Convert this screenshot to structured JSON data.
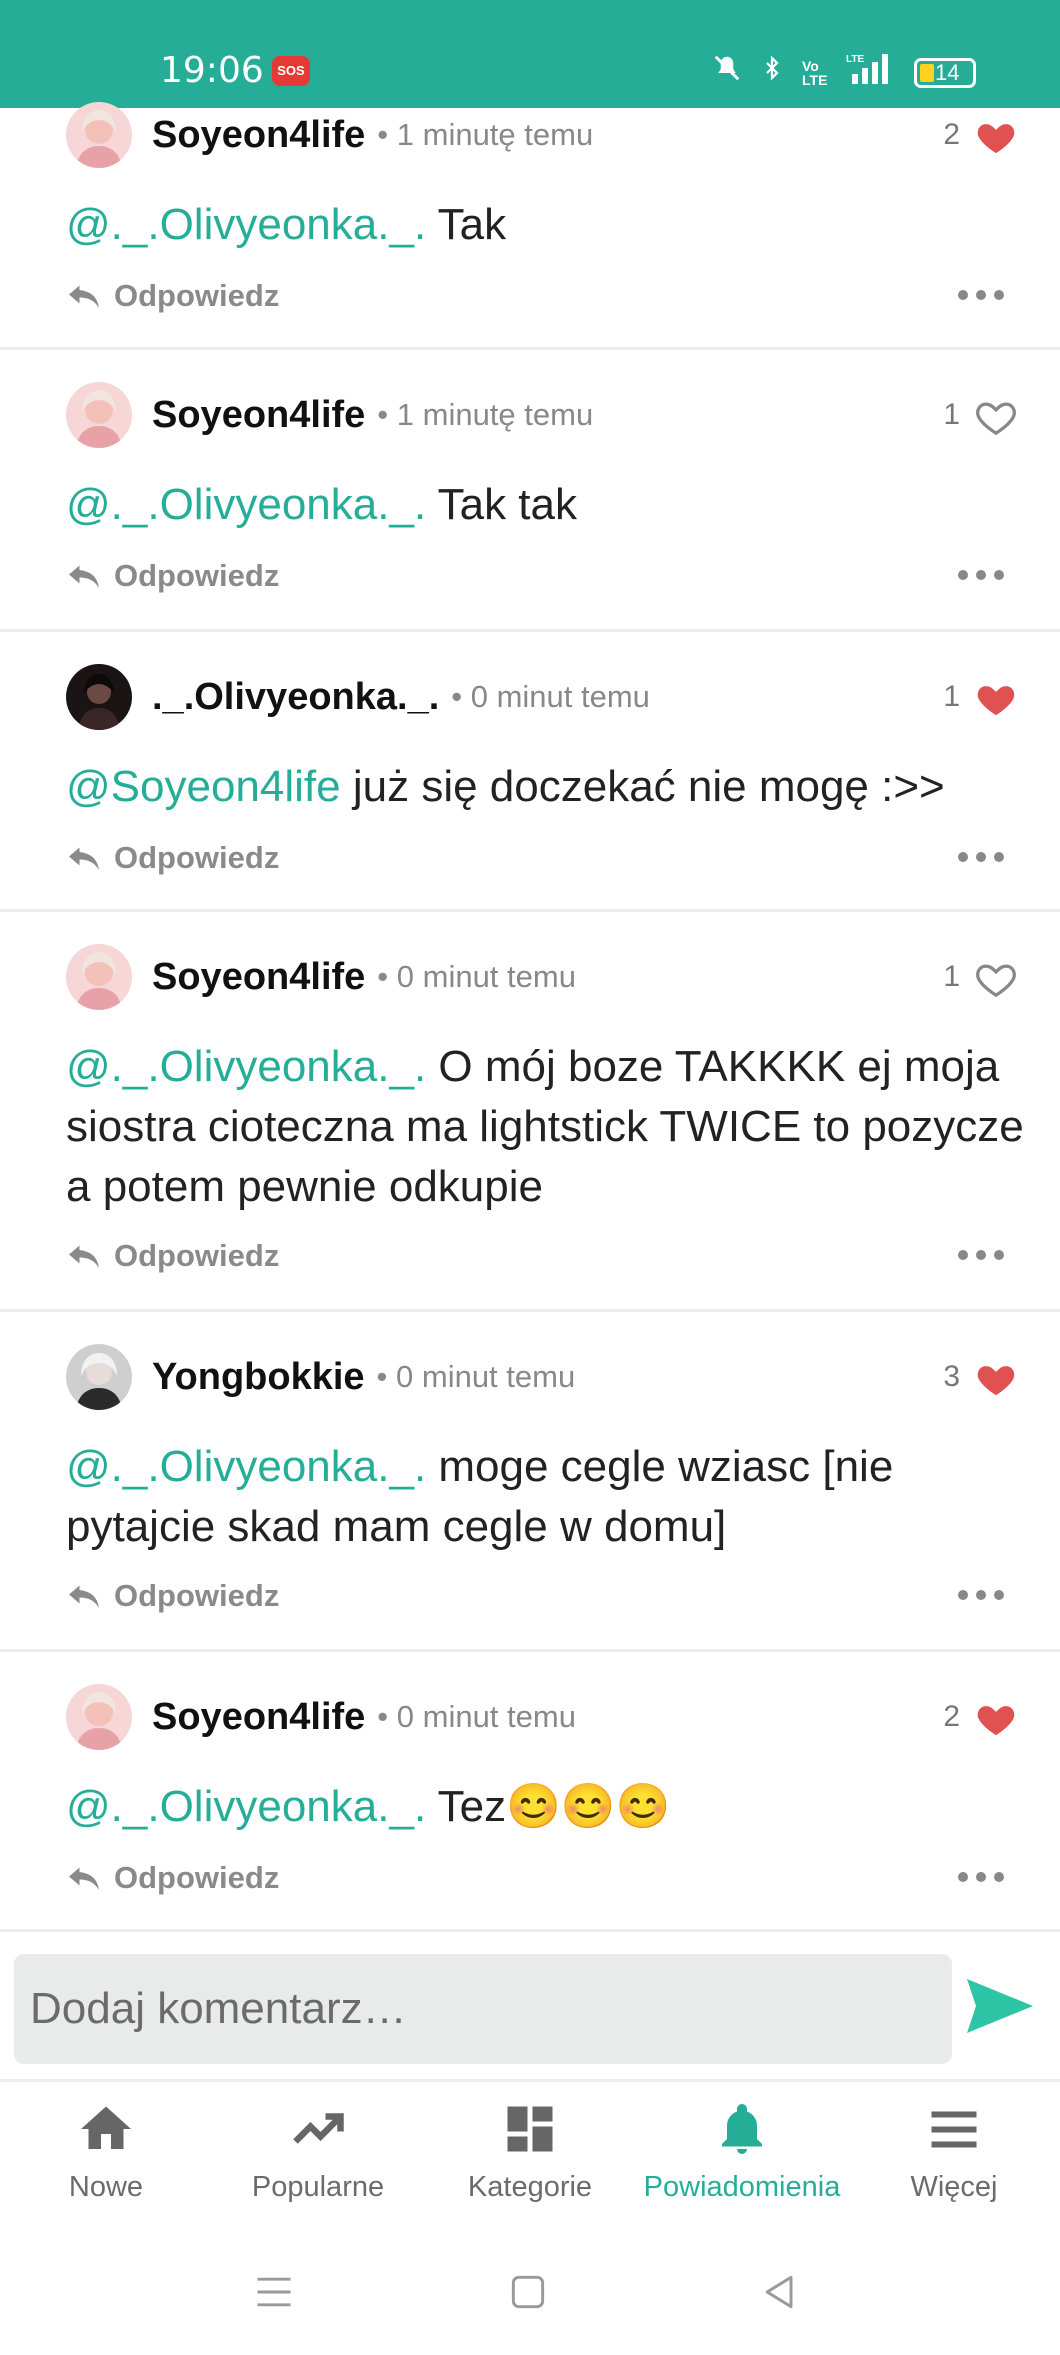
{
  "status_bar": {
    "time": "19:06",
    "sos": "SOS",
    "volte": "Vo LTE",
    "lte": "LTE",
    "battery": "14"
  },
  "colors": {
    "accent": "#26ad98",
    "heart_red": "#e05252",
    "mention": "#26ad98"
  },
  "comments": [
    {
      "user": "Soyeon4life",
      "time": "• 1 minutę temu",
      "likes": "2",
      "liked": true,
      "mention": "@._.Olivyeonka._.",
      "text": " Tak",
      "reply": "Odpowiedz",
      "avatar": "pink"
    },
    {
      "user": "Soyeon4life",
      "time": "• 1 minutę temu",
      "likes": "1",
      "liked": false,
      "mention": "@._.Olivyeonka._.",
      "text": " Tak tak",
      "reply": "Odpowiedz",
      "avatar": "pink"
    },
    {
      "user": "._.Olivyeonka._.",
      "time": "• 0 minut temu",
      "likes": "1",
      "liked": true,
      "mention": "@Soyeon4life",
      "text": " już się doczekać nie mogę :>>",
      "reply": "Odpowiedz",
      "avatar": "dark"
    },
    {
      "user": "Soyeon4life",
      "time": "• 0 minut temu",
      "likes": "1",
      "liked": false,
      "mention": "@._.Olivyeonka._.",
      "text": " O mój boze TAKKKK ej moja siostra cioteczna ma lightstick TWICE to pozycze a potem pewnie odkupie",
      "reply": "Odpowiedz",
      "avatar": "pink"
    },
    {
      "user": "Yongbokkie",
      "time": "• 0 minut temu",
      "likes": "3",
      "liked": true,
      "mention": "@._.Olivyeonka._.",
      "text": " moge cegle wziasc [nie pytajcie skad mam cegle w domu]",
      "reply": "Odpowiedz",
      "avatar": "gray"
    },
    {
      "user": "Soyeon4life",
      "time": "• 0 minut temu",
      "likes": "2",
      "liked": true,
      "mention": "@._.Olivyeonka._.",
      "text": " Tez😊😊😊",
      "reply": "Odpowiedz",
      "avatar": "pink"
    }
  ],
  "composer": {
    "placeholder": "Dodaj komentarz…"
  },
  "nav": [
    {
      "label": "Nowe",
      "icon": "home-icon"
    },
    {
      "label": "Popularne",
      "icon": "trending-icon"
    },
    {
      "label": "Kategorie",
      "icon": "dashboard-icon"
    },
    {
      "label": "Powiadomienia",
      "icon": "bell-icon"
    },
    {
      "label": "Więcej",
      "icon": "menu-icon"
    }
  ]
}
